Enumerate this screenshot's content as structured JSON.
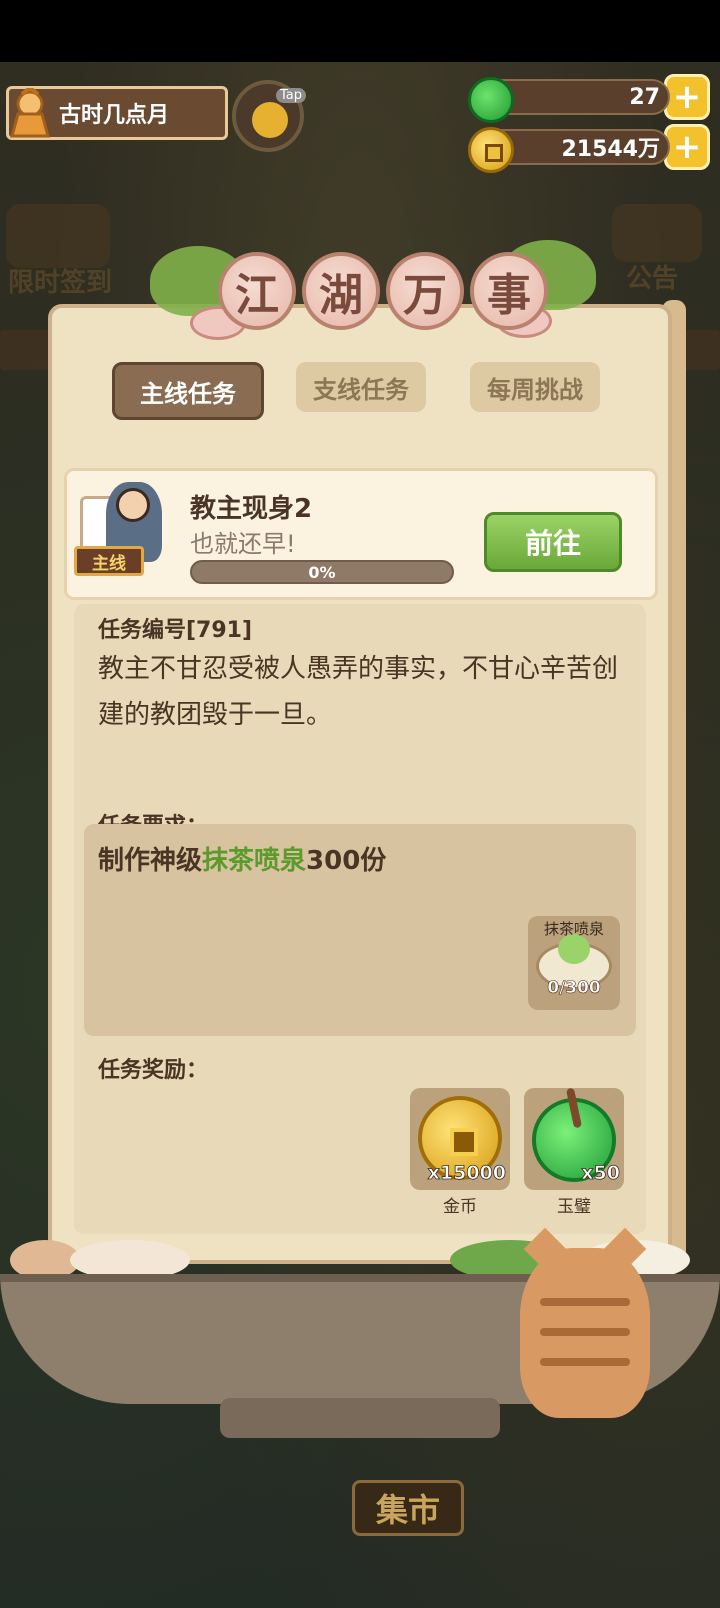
{
  "player": {
    "name": "古时几点月"
  },
  "tap_badge": "Tap",
  "resources": {
    "jade": {
      "value": "27",
      "icon": "jade-icon"
    },
    "coins": {
      "value": "21544万",
      "icon": "coin-icon"
    },
    "plus": "+"
  },
  "background_labels": {
    "left": "限时签到",
    "right": "公告"
  },
  "panel": {
    "title_chars": [
      "江",
      "湖",
      "万",
      "事"
    ],
    "tabs": [
      {
        "label": "主线任务",
        "active": true
      },
      {
        "label": "支线任务",
        "active": false
      },
      {
        "label": "每周挑战",
        "active": false
      }
    ],
    "task": {
      "tag": "主线",
      "title": "教主现身2",
      "subtitle": "也就还早!",
      "progress_text": "0%",
      "progress": 0,
      "go_button": "前往"
    },
    "task_number_label": "任务编号[791]",
    "description": "教主不甘忍受被人愚弄的事实，不甘心辛苦创建的教团毁于一旦。",
    "requirement_label": "任务要求：",
    "requirement": {
      "prefix": "制作神级",
      "item": "抹茶喷泉",
      "suffix": "300份",
      "item_name": "抹茶喷泉",
      "item_count": "0/300"
    },
    "reward_label": "任务奖励：",
    "rewards": [
      {
        "qty": "x15000",
        "name": "金币",
        "icon": "coin-icon"
      },
      {
        "qty": "x50",
        "name": "玉璧",
        "icon": "jade-icon"
      }
    ]
  },
  "market_button": "集市"
}
